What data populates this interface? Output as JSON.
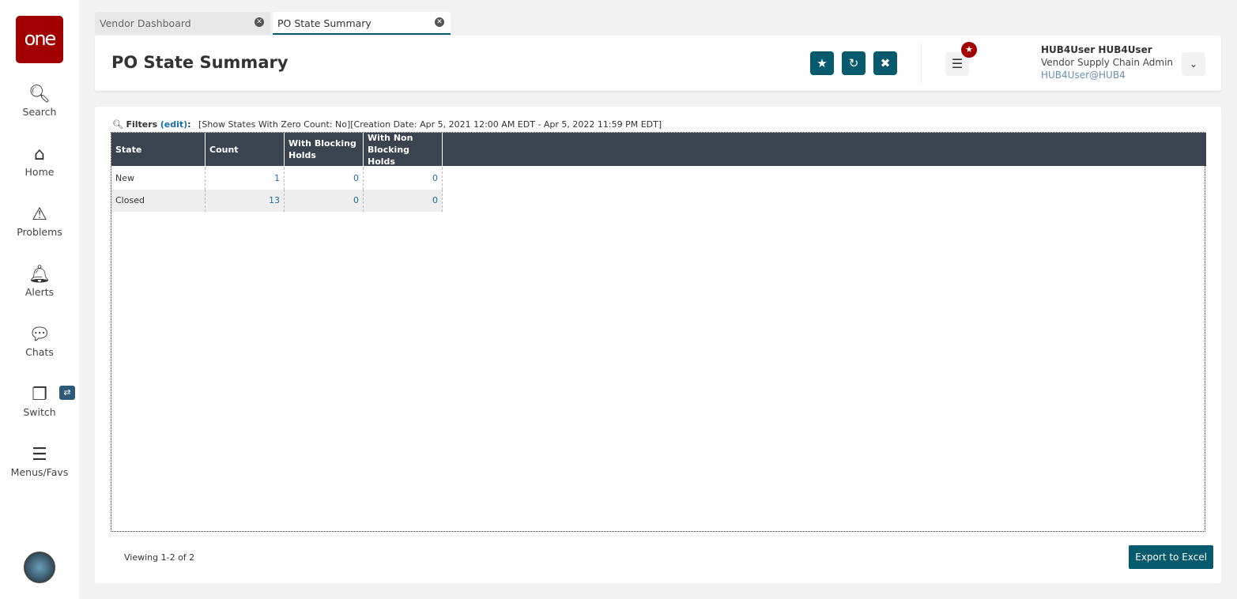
{
  "sidebar": {
    "logo": "one",
    "items": [
      {
        "label": "Search"
      },
      {
        "label": "Home"
      },
      {
        "label": "Problems"
      },
      {
        "label": "Alerts"
      },
      {
        "label": "Chats"
      },
      {
        "label": "Switch"
      },
      {
        "label": "Menus/Favs"
      }
    ]
  },
  "tabs": [
    {
      "label": "Vendor Dashboard"
    },
    {
      "label": "PO State Summary"
    }
  ],
  "header": {
    "title": "PO State Summary",
    "user_name": "HUB4User HUB4User",
    "user_role": "Vendor Supply Chain Admin",
    "user_email": "HUB4User@HUB4"
  },
  "filters": {
    "label": "Filters",
    "edit": "(edit)",
    "colon": ":",
    "text": "[Show States With Zero Count: No][Creation Date: Apr 5, 2021 12:00 AM EDT - Apr 5, 2022 11:59 PM EDT]"
  },
  "table": {
    "columns": [
      "State",
      "Count",
      "With Blocking Holds",
      "With Non Blocking Holds"
    ],
    "rows": [
      [
        "New",
        "1",
        "0",
        "0"
      ],
      [
        "Closed",
        "13",
        "0",
        "0"
      ]
    ]
  },
  "footer": {
    "viewing": "Viewing 1-2 of 2",
    "export": "Export to Excel"
  }
}
